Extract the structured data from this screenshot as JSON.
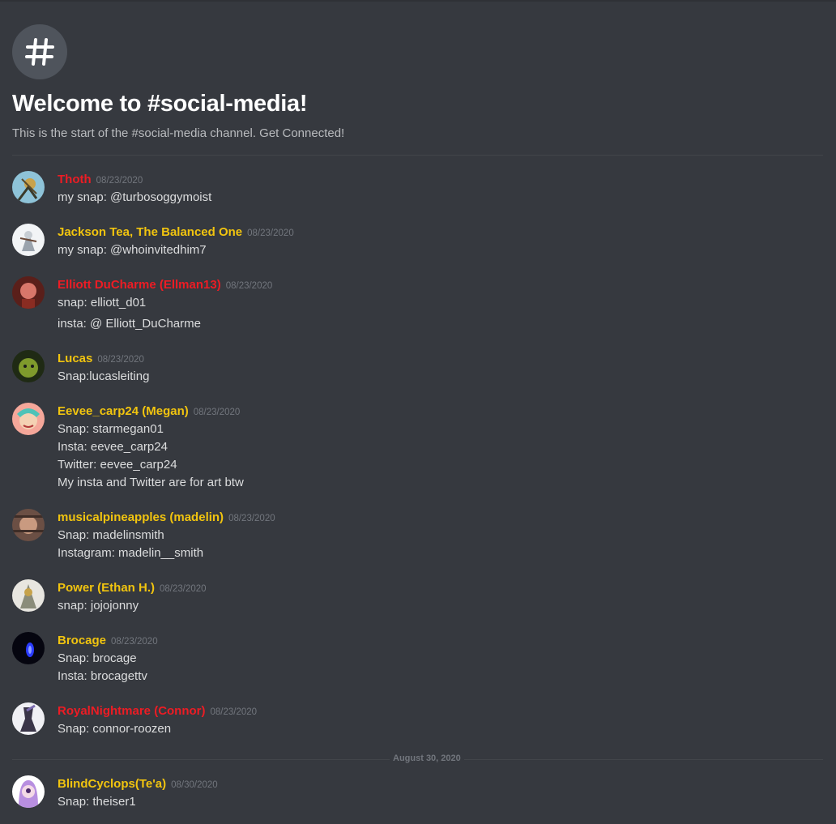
{
  "channel": {
    "welcome_title": "Welcome to #social-media!",
    "welcome_subtitle": "This is the start of the #social-media channel. Get Connected!"
  },
  "colors": {
    "role_red": "#ed1c24",
    "role_gold": "#f1c40f",
    "background": "#36393f"
  },
  "messages": [
    {
      "username": "Thoth",
      "color": "#ed1c24",
      "timestamp": "08/23/2020",
      "lines": [
        "my snap: @turbosoggymoist"
      ]
    },
    {
      "username": "Jackson Tea, The Balanced One",
      "color": "#f1c40f",
      "timestamp": "08/23/2020",
      "lines": [
        "my snap: @whoinvitedhim7"
      ]
    },
    {
      "username": "Elliott DuCharme (Ellman13)",
      "color": "#ed1c24",
      "timestamp": "08/23/2020",
      "lines": [
        "snap: elliott_d01",
        "insta: @ Elliott_DuCharme"
      ]
    },
    {
      "username": "Lucas",
      "color": "#f1c40f",
      "timestamp": "08/23/2020",
      "lines": [
        "Snap:lucasleiting"
      ]
    },
    {
      "username": "Eevee_carp24 (Megan)",
      "color": "#f1c40f",
      "timestamp": "08/23/2020",
      "lines": [
        "Snap: starmegan01",
        "Insta: eevee_carp24",
        "Twitter: eevee_carp24",
        "My insta and Twitter are for art btw"
      ]
    },
    {
      "username": "musicalpineapples (madelin)",
      "color": "#f1c40f",
      "timestamp": "08/23/2020",
      "lines": [
        "Snap: madelinsmith",
        "Instagram: madelin__smith"
      ]
    },
    {
      "username": "Power (Ethan H.)",
      "color": "#f1c40f",
      "timestamp": "08/23/2020",
      "lines": [
        "snap: jojojonny"
      ]
    },
    {
      "username": "Brocage",
      "color": "#f1c40f",
      "timestamp": "08/23/2020",
      "lines": [
        "Snap: brocage",
        "Insta: brocagettv"
      ]
    },
    {
      "username": "RoyalNightmare (Connor)",
      "color": "#ed1c24",
      "timestamp": "08/23/2020",
      "lines": [
        "Snap: connor-roozen"
      ]
    },
    {
      "username": "BlindCyclops(Te'a)",
      "color": "#f1c40f",
      "timestamp": "08/30/2020",
      "lines": [
        "Snap: theiser1"
      ]
    }
  ],
  "date_separator": "August 30, 2020"
}
